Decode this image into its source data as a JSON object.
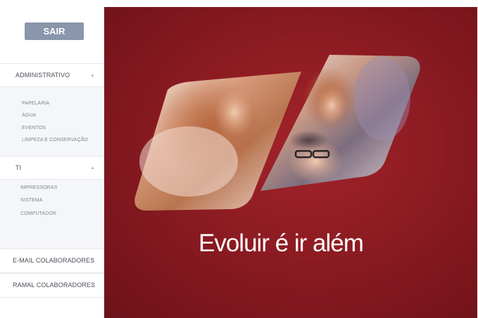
{
  "sidebar": {
    "logout_label": "SAIR",
    "sections": [
      {
        "title": "ADMINISTRATIVO",
        "expanded": true,
        "items": [
          "PAPELARIA",
          "ÁGUA",
          "EVENTOS",
          "LIMPEZA E CONSERVAÇÃO"
        ]
      },
      {
        "title": "TI",
        "expanded": true,
        "items": [
          "IMPRESSORAS",
          "SISTEMA",
          "COMPUTADOR"
        ]
      },
      {
        "title": "E-MAIL COLABORADORES",
        "expanded": false
      },
      {
        "title": "RAMAL COLABORADORES",
        "expanded": false
      }
    ],
    "icons": {
      "expanded": "chevron-up-icon",
      "collapsed": "chevron-down-icon"
    }
  },
  "hero": {
    "tagline": "Evoluir é ir além",
    "colors": {
      "background": "#8c1b22",
      "text": "#ffffff"
    }
  },
  "colors": {
    "logout_button": "#8a96ac",
    "submenu_background": "#f5f6f9",
    "menu_text": "#4a4f57"
  }
}
